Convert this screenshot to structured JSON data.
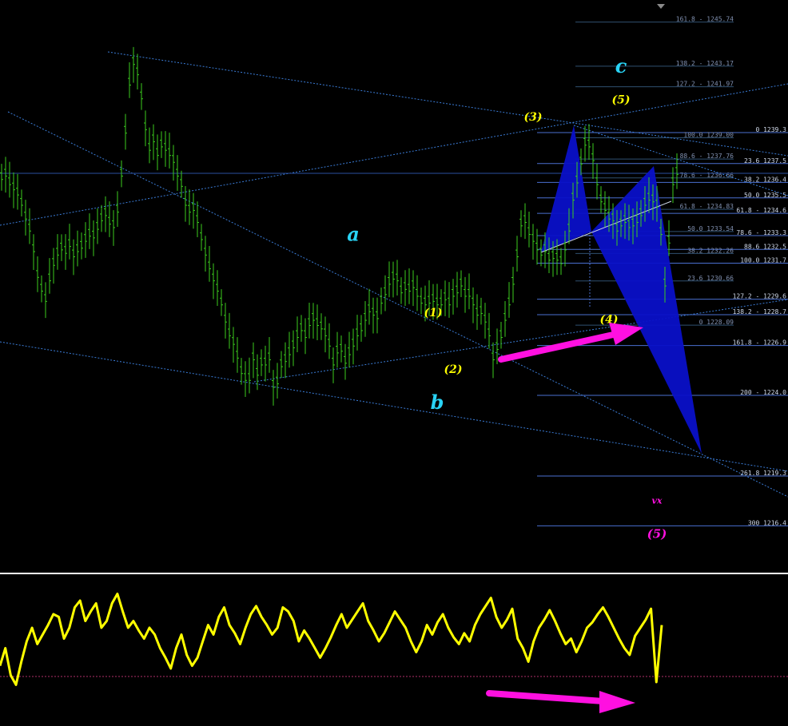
{
  "chart_data": {
    "type": "candlestick",
    "colors": {
      "background": "#000000",
      "candles": "#3ccd1e",
      "oscillator": "#ffff00",
      "fib_lines": "#4a6fd0",
      "fib_text": "#8090b0",
      "fib_text_white": "#cfd8e8",
      "trendlines": "#3a7bd5",
      "pattern_fill": "#0a10c8",
      "wave_labels": "#ffff00",
      "abc_labels": "#29d3f5",
      "magenta": "#ff10e0",
      "separator": "#ffffff",
      "zero_line": "#b0306a"
    },
    "price_range": [
      1214.0,
      1246.0
    ],
    "price_candles": [
      1236.7,
      1236.9,
      1236.4,
      1236.1,
      1235.8,
      1235.2,
      1234.4,
      1233.7,
      1232.5,
      1231.0,
      1230.2,
      1229.6,
      1230.8,
      1231.7,
      1232.3,
      1232.6,
      1232.4,
      1232.8,
      1232.2,
      1232.5,
      1232.7,
      1233.1,
      1233.4,
      1233.3,
      1233.8,
      1234.3,
      1234.6,
      1234.1,
      1233.9,
      1234.8,
      1236.9,
      1239.4,
      1242.2,
      1243.4,
      1242.8,
      1241.4,
      1239.6,
      1238.4,
      1238.9,
      1238.1,
      1238.6,
      1238.4,
      1238.1,
      1237.7,
      1236.9,
      1236.3,
      1235.2,
      1234.8,
      1234.9,
      1234.2,
      1233.2,
      1232.3,
      1231.5,
      1230.8,
      1230.2,
      1229.4,
      1228.4,
      1227.6,
      1227.1,
      1226.3,
      1225.4,
      1225.0,
      1225.0,
      1226.2,
      1225.3,
      1225.9,
      1225.9,
      1226.2,
      1224.6,
      1224.8,
      1225.8,
      1226.1,
      1226.5,
      1226.9,
      1227.5,
      1227.9,
      1227.5,
      1228.2,
      1228.5,
      1228.2,
      1228.0,
      1227.6,
      1227.0,
      1225.9,
      1226.6,
      1226.7,
      1226.0,
      1226.5,
      1227.0,
      1227.6,
      1227.9,
      1228.5,
      1229.0,
      1228.8,
      1228.6,
      1229.5,
      1230.0,
      1230.6,
      1230.9,
      1230.8,
      1230.1,
      1230.3,
      1230.2,
      1230.4,
      1229.9,
      1229.5,
      1229.4,
      1229.5,
      1229.6,
      1229.4,
      1229.4,
      1229.7,
      1229.4,
      1229.9,
      1230.1,
      1230.5,
      1229.9,
      1229.9,
      1229.4,
      1228.8,
      1228.9,
      1228.4,
      1227.6,
      1226.2,
      1226.8,
      1227.5,
      1228.5,
      1229.4,
      1230.6,
      1232.2,
      1234.0,
      1234.2,
      1233.5,
      1233.1,
      1232.6,
      1232.3,
      1232.5,
      1232.0,
      1232.1,
      1232.0,
      1231.8,
      1232.6,
      1233.7,
      1235.5,
      1236.5,
      1237.6,
      1238.7,
      1238.6,
      1237.8,
      1236.4,
      1235.4,
      1234.9,
      1234.4,
      1234.3,
      1233.7,
      1234.0,
      1234.2,
      1233.9,
      1234.0,
      1234.2,
      1234.6,
      1235.2,
      1235.5,
      1235.4,
      1235.1,
      1233.5,
      1230.5,
      1233.0,
      1236.4,
      1237.0
    ],
    "price_candle_range": 1.3,
    "oscillator": [
      42,
      55,
      35,
      28,
      45,
      60,
      70,
      58,
      65,
      72,
      80,
      78,
      62,
      70,
      85,
      90,
      75,
      82,
      88,
      70,
      75,
      88,
      95,
      82,
      70,
      75,
      68,
      62,
      70,
      65,
      55,
      48,
      40,
      55,
      65,
      50,
      42,
      48,
      60,
      72,
      65,
      78,
      85,
      72,
      66,
      58,
      70,
      80,
      86,
      78,
      72,
      65,
      70,
      85,
      82,
      75,
      60,
      68,
      62,
      55,
      48,
      55,
      63,
      72,
      80,
      70,
      76,
      82,
      88,
      75,
      68,
      60,
      66,
      74,
      82,
      76,
      70,
      60,
      52,
      60,
      72,
      65,
      74,
      80,
      70,
      63,
      58,
      66,
      60,
      72,
      80,
      86,
      92,
      78,
      70,
      76,
      84,
      62,
      55,
      45,
      60,
      70,
      76,
      83,
      75,
      66,
      58,
      62,
      52,
      60,
      70,
      74,
      80,
      85,
      78,
      70,
      62,
      55,
      50,
      64,
      70,
      76,
      84,
      30,
      72
    ],
    "oscillator_range": [
      0,
      100
    ],
    "oscillator_zero": 52,
    "fib_levels_right": [
      {
        "label": "0 1239.3",
        "price": 1239.3
      },
      {
        "label": "23.6 1237.5",
        "price": 1237.5
      },
      {
        "label": "38.2 1236.4",
        "price": 1236.4
      },
      {
        "label": "50.0 1235.5",
        "price": 1235.5
      },
      {
        "label": "61.8 - 1234.6",
        "price": 1234.6
      },
      {
        "label": "78.6 - 1233.3",
        "price": 1233.3
      },
      {
        "label": "88.6 1232.5",
        "price": 1232.5
      },
      {
        "label": "100.0 1231.7",
        "price": 1231.7
      },
      {
        "label": "127.2 - 1229.6",
        "price": 1229.6
      },
      {
        "label": "138.2 - 1228.7",
        "price": 1228.7
      },
      {
        "label": "161.8 - 1226.9",
        "price": 1226.9
      },
      {
        "label": "200 - 1224.0",
        "price": 1224.0
      },
      {
        "label": "261.8 1219.3",
        "price": 1219.3
      },
      {
        "label": "300 1216.4",
        "price": 1216.4
      }
    ],
    "fib_levels_mid": [
      {
        "label": "161.8 - 1245.74",
        "price": 1245.74
      },
      {
        "label": "138.2 - 1243.17",
        "price": 1243.17
      },
      {
        "label": "127.2 - 1241.97",
        "price": 1241.97
      },
      {
        "label": "100.0 1239.00",
        "price": 1239.0
      },
      {
        "label": "88.6 - 1237.76",
        "price": 1237.76
      },
      {
        "label": "78.6 - 1236.66",
        "price": 1236.66
      },
      {
        "label": "61.8 - 1234.83",
        "price": 1234.83
      },
      {
        "label": "50.0 1233.54",
        "price": 1233.54
      },
      {
        "label": "38.2 1232.26",
        "price": 1232.26
      },
      {
        "label": "23.6 1230.66",
        "price": 1230.66
      },
      {
        "label": "0 1228.09",
        "price": 1228.09
      }
    ],
    "wave_labels": [
      {
        "text": "(1)",
        "bar": 108,
        "price": 1228.6
      },
      {
        "text": "(2)",
        "bar": 113,
        "price": 1225.3
      },
      {
        "text": "(3)",
        "bar": 133,
        "price": 1240.0
      },
      {
        "text": "(4)",
        "bar": 152,
        "price": 1228.2
      },
      {
        "text": "(5)",
        "bar": 155,
        "price": 1241.0
      }
    ],
    "abc_labels": [
      {
        "text": "a",
        "bar": 88,
        "price": 1233.0
      },
      {
        "text": "b",
        "bar": 109,
        "price": 1223.2
      },
      {
        "text": "c",
        "bar": 155,
        "price": 1242.8
      }
    ],
    "magenta_labels": [
      {
        "text": "vx",
        "bar": 164,
        "price": 1217.7
      },
      {
        "text": "(5)",
        "bar": 164,
        "price": 1215.7
      }
    ]
  }
}
